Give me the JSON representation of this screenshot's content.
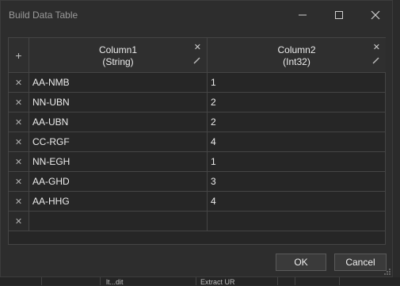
{
  "window": {
    "title": "Build Data Table"
  },
  "table": {
    "add_symbol": "+",
    "delete_symbol": "✕",
    "columns": [
      {
        "name": "Column1",
        "type": "(String)"
      },
      {
        "name": "Column2",
        "type": "(Int32)"
      }
    ],
    "rows": [
      [
        "AA-NMB",
        "1"
      ],
      [
        "NN-UBN",
        "2"
      ],
      [
        "AA-UBN",
        "2"
      ],
      [
        "CC-RGF",
        "4"
      ],
      [
        "NN-EGH",
        "1"
      ],
      [
        "AA-GHD",
        "3"
      ],
      [
        "AA-HHG",
        "4"
      ],
      [
        "",
        ""
      ]
    ]
  },
  "buttons": {
    "ok": "OK",
    "cancel": "Cancel"
  },
  "background": {
    "fragments": [
      "lt...dit",
      "Extract UR"
    ]
  }
}
